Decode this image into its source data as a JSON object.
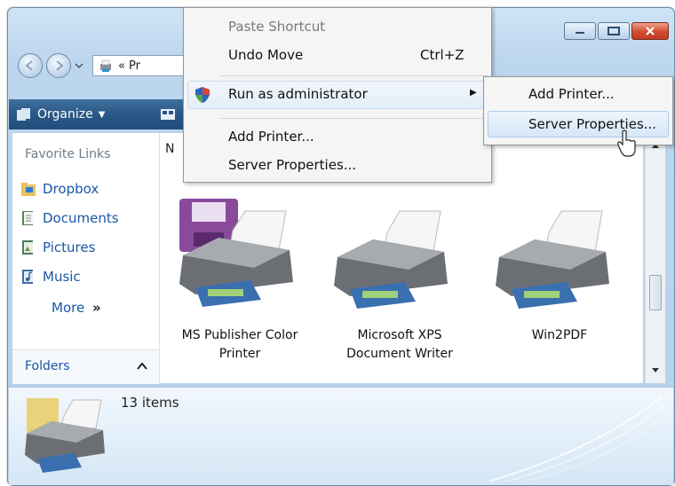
{
  "window": {
    "address_text": "Pr",
    "organize_label": "Organize"
  },
  "sidebar": {
    "title": "Favorite Links",
    "links": [
      {
        "label": "Dropbox",
        "icon": "dropbox-folder-icon"
      },
      {
        "label": "Documents",
        "icon": "documents-icon"
      },
      {
        "label": "Pictures",
        "icon": "pictures-icon"
      },
      {
        "label": "Music",
        "icon": "music-icon"
      }
    ],
    "more_label": "More",
    "more_glyph": "»",
    "folders_label": "Folders"
  },
  "content": {
    "column_header": "N",
    "items": [
      {
        "line1": "MS Publisher Color",
        "line2": "Printer"
      },
      {
        "line1": "Microsoft XPS",
        "line2": "Document Writer"
      },
      {
        "line1": "Win2PDF",
        "line2": ""
      }
    ]
  },
  "status": {
    "count": "13 items"
  },
  "context_menu": {
    "items": [
      {
        "label": "Paste Shortcut",
        "shortcut": "",
        "disabled": true
      },
      {
        "label": "Undo Move",
        "shortcut": "Ctrl+Z"
      },
      {
        "label": "Run as administrator",
        "submenu_arrow": "▶"
      },
      {
        "label": "Add Printer..."
      },
      {
        "label": "Server Properties..."
      }
    ]
  },
  "submenu": {
    "items": [
      {
        "label": "Add Printer..."
      },
      {
        "label": "Server Properties..."
      }
    ]
  },
  "colors": {
    "toolbar": "#2a5886",
    "link": "#1a56a8",
    "menu_bg": "#f5f5f5",
    "highlight": "#d6e7f8"
  }
}
